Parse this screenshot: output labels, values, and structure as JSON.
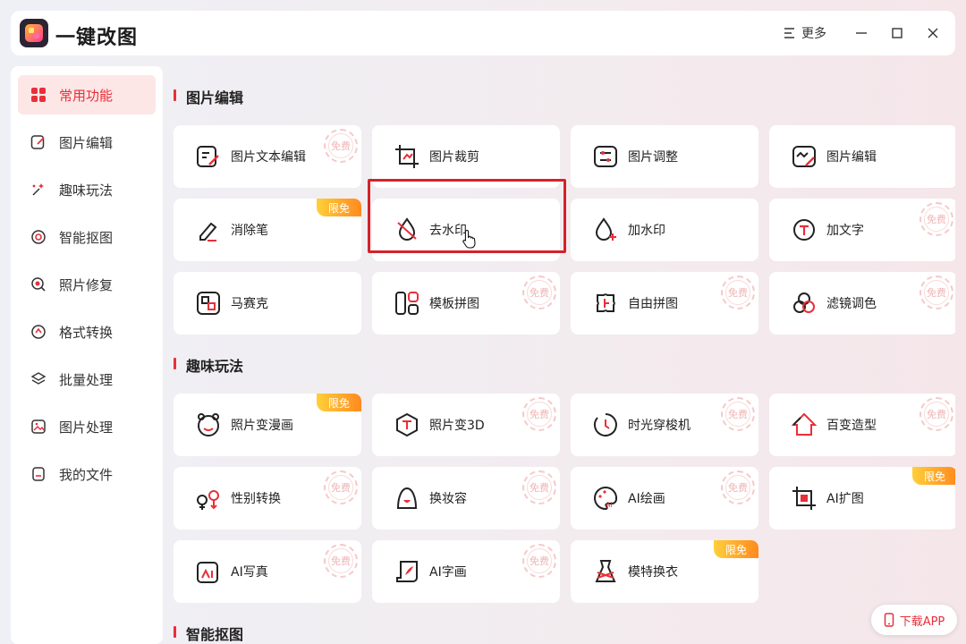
{
  "app": {
    "title": "一键改图",
    "more_label": "更多"
  },
  "sidebar": {
    "items": [
      {
        "label": "常用功能",
        "icon": "grid-icon",
        "active": true
      },
      {
        "label": "图片编辑",
        "icon": "edit-icon"
      },
      {
        "label": "趣味玩法",
        "icon": "sparkle-icon"
      },
      {
        "label": "智能抠图",
        "icon": "target-icon"
      },
      {
        "label": "照片修复",
        "icon": "repair-icon"
      },
      {
        "label": "格式转换",
        "icon": "convert-icon"
      },
      {
        "label": "批量处理",
        "icon": "layers-icon"
      },
      {
        "label": "图片处理",
        "icon": "image-icon"
      },
      {
        "label": "我的文件",
        "icon": "file-icon"
      }
    ]
  },
  "sections": [
    {
      "title": "图片编辑",
      "cards": [
        {
          "label": "图片文本编辑",
          "icon": "text-edit-icon",
          "badge": "免费"
        },
        {
          "label": "图片裁剪",
          "icon": "crop-icon",
          "badge": ""
        },
        {
          "label": "图片调整",
          "icon": "adjust-icon",
          "badge": ""
        },
        {
          "label": "图片编辑",
          "icon": "image-edit-icon",
          "badge": ""
        },
        {
          "label": "消除笔",
          "icon": "eraser-pen-icon",
          "badge": "限免"
        },
        {
          "label": "去水印",
          "icon": "remove-watermark-icon",
          "badge": ""
        },
        {
          "label": "加水印",
          "icon": "add-watermark-icon",
          "badge": ""
        },
        {
          "label": "加文字",
          "icon": "add-text-icon",
          "badge": "免费"
        },
        {
          "label": "马赛克",
          "icon": "mosaic-icon",
          "badge": ""
        },
        {
          "label": "模板拼图",
          "icon": "template-collage-icon",
          "badge": "免费"
        },
        {
          "label": "自由拼图",
          "icon": "puzzle-icon",
          "badge": "免费"
        },
        {
          "label": "滤镜调色",
          "icon": "filter-icon",
          "badge": "免费"
        }
      ]
    },
    {
      "title": "趣味玩法",
      "cards": [
        {
          "label": "照片变漫画",
          "icon": "cartoon-icon",
          "badge": "限免"
        },
        {
          "label": "照片变3D",
          "icon": "cube-icon",
          "badge": "免费"
        },
        {
          "label": "时光穿梭机",
          "icon": "clock-icon",
          "badge": "免费"
        },
        {
          "label": "百变造型",
          "icon": "styling-icon",
          "badge": "免费"
        },
        {
          "label": "性别转换",
          "icon": "gender-icon",
          "badge": "免费"
        },
        {
          "label": "换妆容",
          "icon": "makeup-icon",
          "badge": "免费"
        },
        {
          "label": "AI绘画",
          "icon": "ai-paint-icon",
          "badge": "免费"
        },
        {
          "label": "AI扩图",
          "icon": "ai-expand-icon",
          "badge": "限免"
        },
        {
          "label": "AI写真",
          "icon": "ai-portrait-icon",
          "badge": "免费"
        },
        {
          "label": "AI字画",
          "icon": "ai-calligraphy-icon",
          "badge": "免费"
        },
        {
          "label": "模特换衣",
          "icon": "dress-icon",
          "badge": "限免"
        }
      ]
    },
    {
      "title": "智能抠图",
      "cards": []
    }
  ],
  "download": {
    "label": "下载APP"
  },
  "colors": {
    "accent": "#e8303a",
    "limit_badge": "#ff9a1f"
  }
}
